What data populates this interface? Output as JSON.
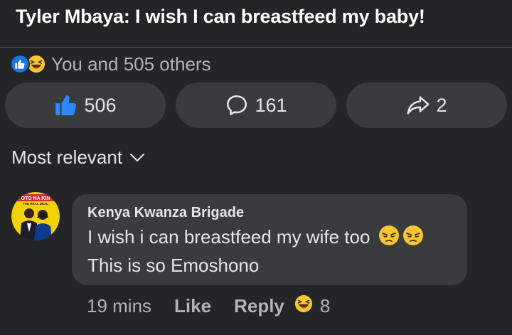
{
  "post": {
    "title": "Tyler Mbaya: I wish I can breastfeed my baby!"
  },
  "reactions": {
    "summary_text": "You and 505 others",
    "icons": [
      "like-reaction-icon",
      "haha-reaction-icon"
    ]
  },
  "actions": {
    "like_count": "506",
    "comment_count": "161",
    "share_count": "2"
  },
  "sort": {
    "label": "Most relevant"
  },
  "comment": {
    "author": "Kenya Kwanza Brigade",
    "line1": "I wish i can breastfeed my wife too",
    "line2": "This is so Emoshono",
    "avatar_text_top": "OTO NA KIN",
    "avatar_text_sub": "THE REAL DEAL",
    "time": "19 mins",
    "like_label": "Like",
    "reply_label": "Reply",
    "reaction_count": "8"
  },
  "colors": {
    "background": "#242526",
    "button_bg": "#3a3b3c",
    "like_blue": "#1b74e4",
    "text": "#e4e6eb",
    "muted": "#b0b3b8",
    "emoji_yellow": "#f7c531"
  }
}
